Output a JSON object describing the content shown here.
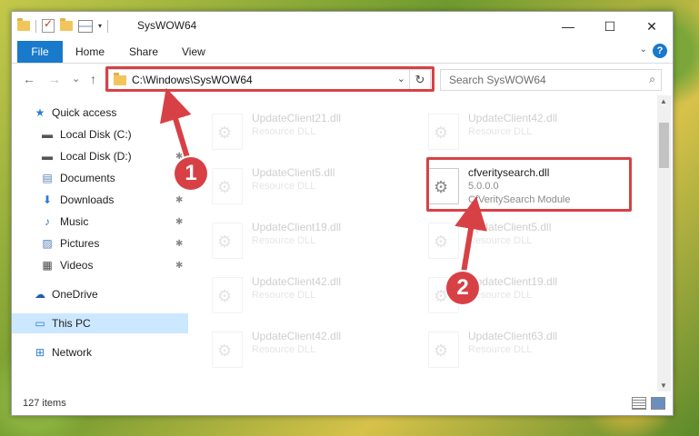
{
  "window": {
    "title": "SysWOW64",
    "minimize_icon": "—",
    "maximize_icon": "☐",
    "close_icon": "✕"
  },
  "ribbon": {
    "tabs": [
      "File",
      "Home",
      "Share",
      "View"
    ],
    "help": "?"
  },
  "nav": {
    "back": "←",
    "forward": "→",
    "recent": "⌄",
    "up": "↑",
    "address": "C:\\Windows\\SysWOW64",
    "refresh": "↻",
    "search_placeholder": "Search SysWOW64",
    "search_icon": "⌕"
  },
  "sidebar": {
    "items": [
      {
        "label": "Quick access",
        "icon": "★",
        "pinned": false
      },
      {
        "label": "Local Disk (C:)",
        "icon": "▬",
        "pinned": true
      },
      {
        "label": "Local Disk (D:)",
        "icon": "▬",
        "pinned": true
      },
      {
        "label": "Documents",
        "icon": "▤",
        "pinned": true
      },
      {
        "label": "Downloads",
        "icon": "⬇",
        "pinned": true
      },
      {
        "label": "Music",
        "icon": "♪",
        "pinned": true
      },
      {
        "label": "Pictures",
        "icon": "▨",
        "pinned": true
      },
      {
        "label": "Videos",
        "icon": "▦",
        "pinned": true
      },
      {
        "label": "OneDrive",
        "icon": "☁",
        "pinned": false
      },
      {
        "label": "This PC",
        "icon": "▭",
        "pinned": false
      },
      {
        "label": "Network",
        "icon": "⊞",
        "pinned": false
      }
    ],
    "pin_icon": "📌"
  },
  "files": [
    {
      "name": "UpdateClient21.dll",
      "desc": "Resource DLL",
      "faded": true
    },
    {
      "name": "UpdateClient42.dll",
      "desc": "Resource DLL",
      "faded": true
    },
    {
      "name": "UpdateClient5.dll",
      "desc": "Resource DLL",
      "faded": true
    },
    {
      "name": "cfveritysearch.dll",
      "desc": "5.0.0.0",
      "desc2": "CfVeritySearch Module",
      "faded": false
    },
    {
      "name": "UpdateClient19.dll",
      "desc": "Resource DLL",
      "faded": true
    },
    {
      "name": "UpdateClient5.dll",
      "desc": "Resource DLL",
      "faded": true
    },
    {
      "name": "UpdateClient42.dll",
      "desc": "Resource DLL",
      "faded": true
    },
    {
      "name": "UpdateClient19.dll",
      "desc": "Resource DLL",
      "faded": true
    },
    {
      "name": "UpdateClient42.dll",
      "desc": "Resource DLL",
      "faded": true
    },
    {
      "name": "UpdateClient63.dll",
      "desc": "Resource DLL",
      "faded": true
    }
  ],
  "status": {
    "item_count": "127 items"
  },
  "callouts": {
    "step1": "1",
    "step2": "2",
    "accent": "#d74145"
  },
  "colors": {
    "file_tab": "#1979ca",
    "selected_nav": "#cce8ff"
  }
}
